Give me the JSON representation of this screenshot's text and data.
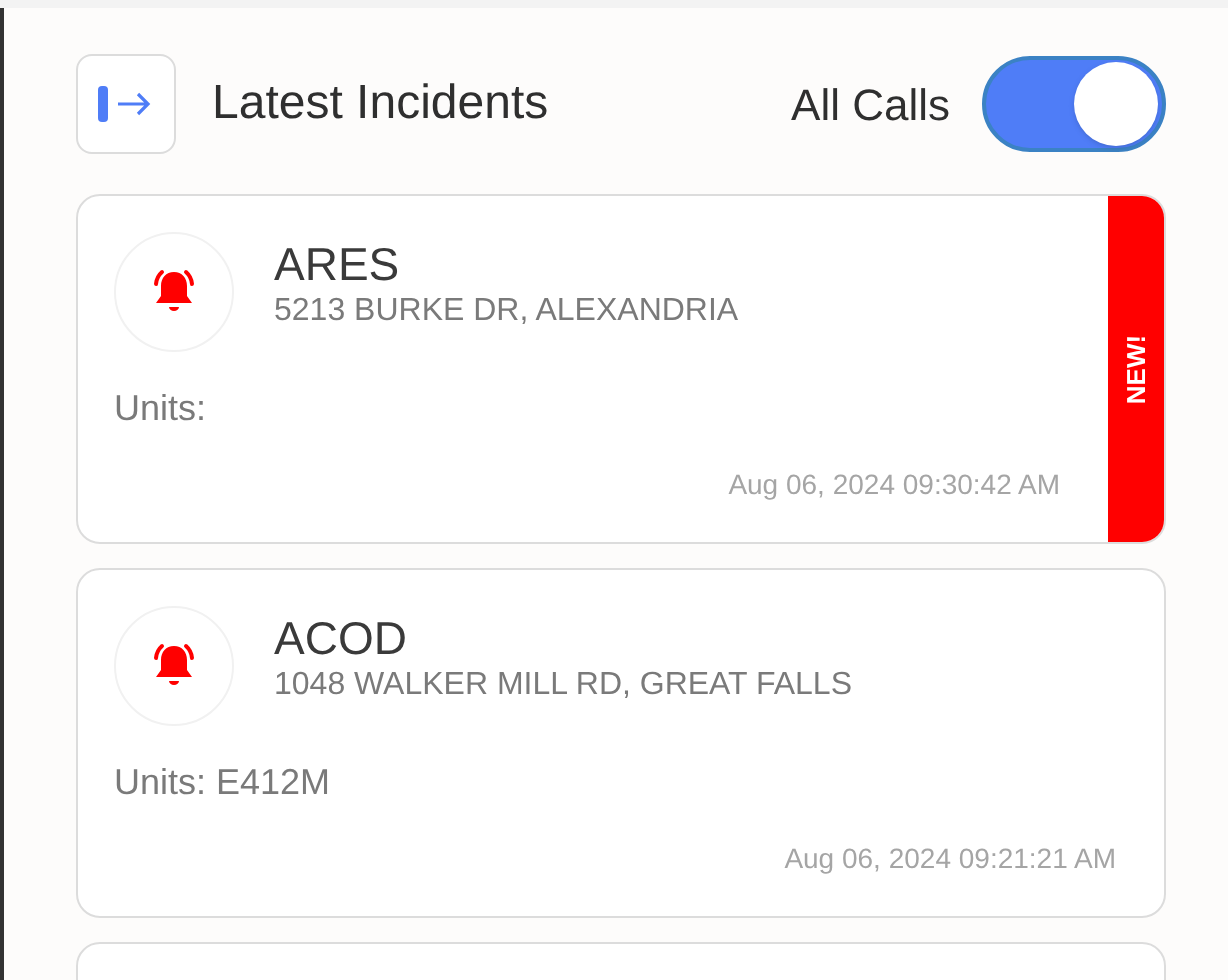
{
  "header": {
    "title": "Latest Incidents",
    "toggle": {
      "label": "All Calls",
      "on": true
    }
  },
  "incidents": [
    {
      "code": "ARES",
      "address": "5213 BURKE DR, ALEXANDRIA",
      "units": "Units:",
      "time": "Aug 06, 2024 09:30:42 AM",
      "new": true,
      "badge": "NEW!"
    },
    {
      "code": "ACOD",
      "address": "1048 WALKER MILL RD, GREAT FALLS",
      "units": "Units: E412M",
      "time": "Aug 06, 2024 09:21:21 AM",
      "new": false
    }
  ]
}
